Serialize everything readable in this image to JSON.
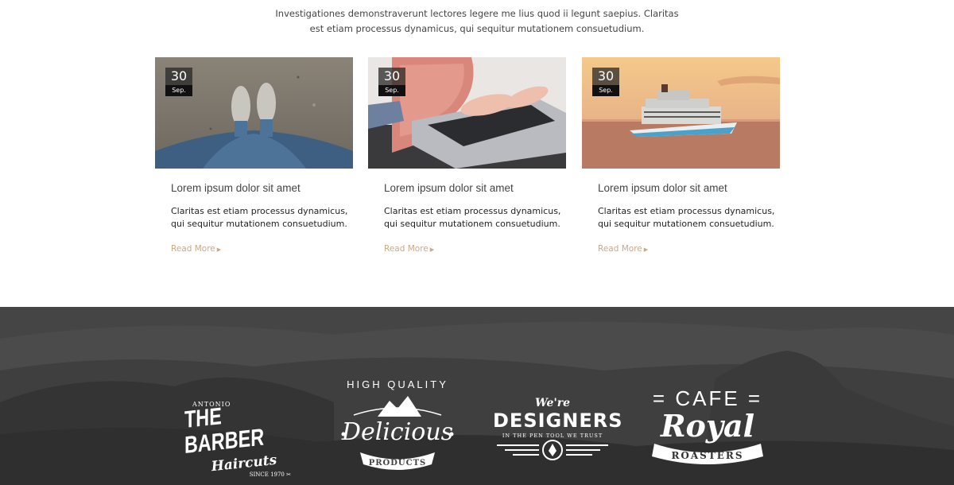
{
  "intro": {
    "line1": "Investigationes demonstraverunt lectores legere me lius quod ii legunt saepius. Claritas",
    "line2": "est etiam processus dynamicus, qui sequitur mutationem consuetudium."
  },
  "posts": [
    {
      "day": "30",
      "month": "Sep.",
      "image": "feet-on-sand",
      "title": "Lorem ipsum dolor sit amet",
      "text1": "Claritas est etiam processus dynamicus,",
      "text2": "qui sequitur mutationem consuetudium.",
      "read_more": "Read More"
    },
    {
      "day": "30",
      "month": "Sep.",
      "image": "typing-on-laptop",
      "title": "Lorem ipsum dolor sit amet",
      "text1": "Claritas est etiam processus dynamicus,",
      "text2": "qui sequitur mutationem consuetudium.",
      "read_more": "Read More"
    },
    {
      "day": "30",
      "month": "Sep.",
      "image": "cruise-ship-sunset",
      "title": "Lorem ipsum dolor sit amet",
      "text1": "Claritas est etiam processus dynamicus,",
      "text2": "qui sequitur mutationem consuetudium.",
      "read_more": "Read More"
    }
  ],
  "colors": {
    "accent": "#c7a98a",
    "footer_bg": "#3e3e3e"
  },
  "brand_logos": [
    {
      "name": "barber",
      "small": "ANTONIO",
      "main": "THE BARBER",
      "script": "Haircuts",
      "since": "SINCE 1970"
    },
    {
      "name": "delicious",
      "arc": "HIGH QUALITY",
      "script": "Delicious",
      "banner": "PRODUCTS"
    },
    {
      "name": "designers",
      "script": "We're",
      "main": "DESIGNERS",
      "tagline": "IN THE PEN TOOL WE TRUST"
    },
    {
      "name": "cafe",
      "top": "CAFE",
      "script": "Royal",
      "banner": "ROASTERS"
    }
  ]
}
